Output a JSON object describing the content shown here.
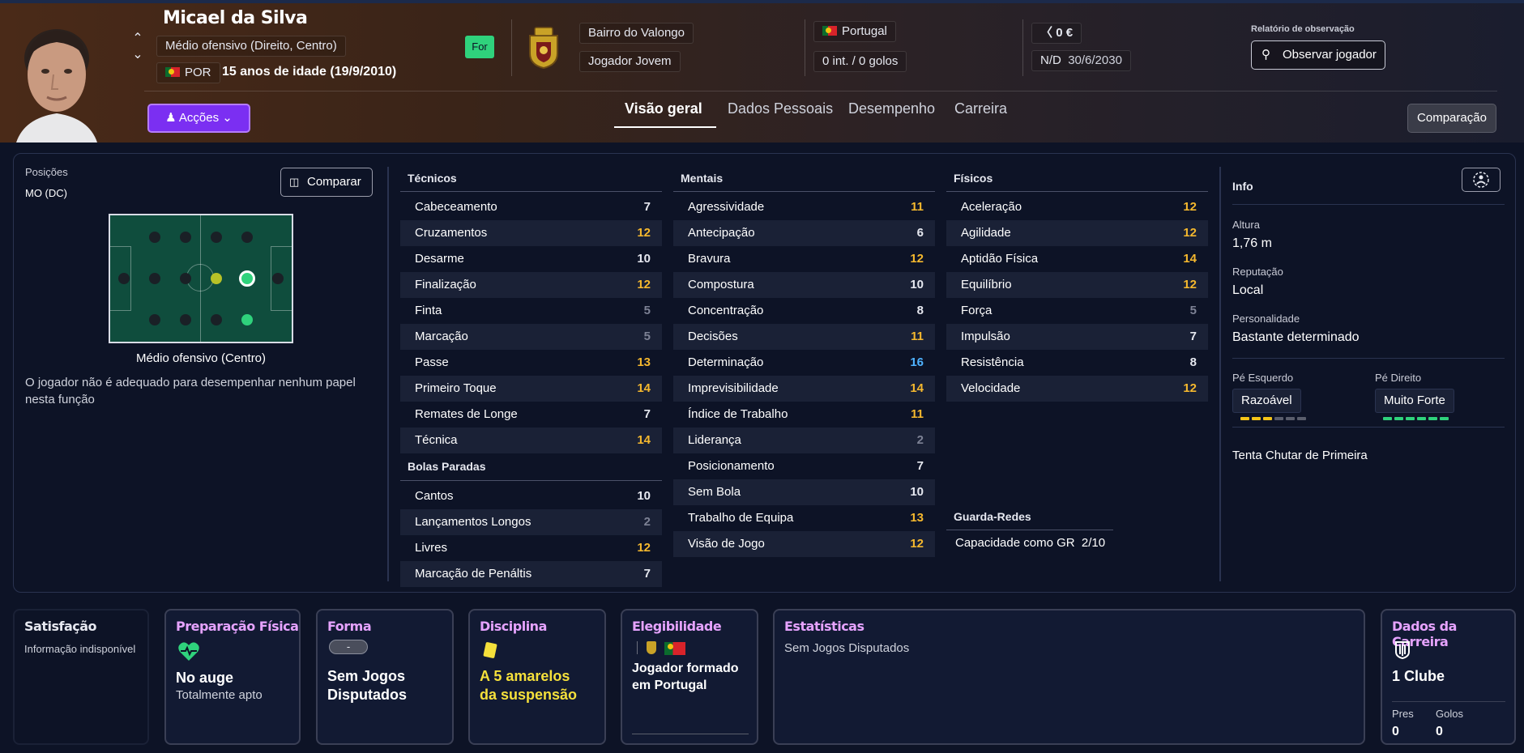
{
  "header": {
    "name": "Micael da Silva",
    "position": "Médio ofensivo (Direito, Centro)",
    "nationality_code": "POR",
    "age_text": "15 anos de idade (19/9/2010)",
    "for_badge": "For",
    "club": "Bairro do Valongo",
    "squad": "Jogador Jovem",
    "country": "Portugal",
    "caps_goals": "0 int. / 0 golos",
    "value": "0 €",
    "contract_label": "N/D",
    "contract_date": "30/6/2030",
    "scout_report_label": "Relatório de observação",
    "observe_button": "Observar jogador",
    "actions_button": "Acções",
    "compare_button": "Comparação",
    "tabs": [
      "Visão geral",
      "Dados Pessoais",
      "Desempenho",
      "Carreira"
    ]
  },
  "positions": {
    "label": "Posições",
    "value": "MO (DC)",
    "compare_button": "Comparar",
    "caption": "Médio ofensivo (Centro)",
    "note": "O jogador não é adequado para desempenhar nenhum papel nesta função"
  },
  "technical": {
    "title": "Técnicos",
    "rows": [
      {
        "name": "Cabeceamento",
        "value": "7"
      },
      {
        "name": "Cruzamentos",
        "value": "12"
      },
      {
        "name": "Desarme",
        "value": "10"
      },
      {
        "name": "Finalização",
        "value": "12"
      },
      {
        "name": "Finta",
        "value": "5"
      },
      {
        "name": "Marcação",
        "value": "5"
      },
      {
        "name": "Passe",
        "value": "13"
      },
      {
        "name": "Primeiro Toque",
        "value": "14"
      },
      {
        "name": "Remates de Longe",
        "value": "7"
      },
      {
        "name": "Técnica",
        "value": "14"
      }
    ]
  },
  "set_pieces": {
    "title": "Bolas Paradas",
    "rows": [
      {
        "name": "Cantos",
        "value": "10"
      },
      {
        "name": "Lançamentos Longos",
        "value": "2"
      },
      {
        "name": "Livres",
        "value": "12"
      },
      {
        "name": "Marcação de Penáltis",
        "value": "7"
      }
    ]
  },
  "mental": {
    "title": "Mentais",
    "rows": [
      {
        "name": "Agressividade",
        "value": "11"
      },
      {
        "name": "Antecipação",
        "value": "6"
      },
      {
        "name": "Bravura",
        "value": "12"
      },
      {
        "name": "Compostura",
        "value": "10"
      },
      {
        "name": "Concentração",
        "value": "8"
      },
      {
        "name": "Decisões",
        "value": "11"
      },
      {
        "name": "Determinação",
        "value": "16"
      },
      {
        "name": "Imprevisibilidade",
        "value": "14"
      },
      {
        "name": "Índice de Trabalho",
        "value": "11"
      },
      {
        "name": "Liderança",
        "value": "2"
      },
      {
        "name": "Posicionamento",
        "value": "7"
      },
      {
        "name": "Sem Bola",
        "value": "10"
      },
      {
        "name": "Trabalho de Equipa",
        "value": "13"
      },
      {
        "name": "Visão de Jogo",
        "value": "12"
      }
    ]
  },
  "physical": {
    "title": "Físicos",
    "rows": [
      {
        "name": "Aceleração",
        "value": "12"
      },
      {
        "name": "Agilidade",
        "value": "12"
      },
      {
        "name": "Aptidão Física",
        "value": "14"
      },
      {
        "name": "Equilíbrio",
        "value": "12"
      },
      {
        "name": "Força",
        "value": "5"
      },
      {
        "name": "Impulsão",
        "value": "7"
      },
      {
        "name": "Resistência",
        "value": "8"
      },
      {
        "name": "Velocidade",
        "value": "12"
      }
    ]
  },
  "goalkeeper": {
    "title": "Guarda-Redes",
    "label": "Capacidade como GR",
    "value": "2/10"
  },
  "info": {
    "title": "Info",
    "height_label": "Altura",
    "height": "1,76 m",
    "reputation_label": "Reputação",
    "reputation": "Local",
    "personality_label": "Personalidade",
    "personality": "Bastante determinado",
    "left_foot_label": "Pé Esquerdo",
    "left_foot": "Razoável",
    "left_foot_level": 3,
    "right_foot_label": "Pé Direito",
    "right_foot": "Muito Forte",
    "right_foot_level": 6,
    "trait": "Tenta Chutar de Primeira"
  },
  "cards": {
    "satisfaction": {
      "title": "Satisfação",
      "text": "Informação indisponível"
    },
    "fitness": {
      "title": "Preparação Física",
      "big": "No auge",
      "small": "Totalmente apto"
    },
    "form": {
      "title": "Forma",
      "chip": "-",
      "big_line1": "Sem Jogos",
      "big_line2": "Disputados"
    },
    "discipline": {
      "title": "Disciplina",
      "big_line1": "A 5 amarelos",
      "big_line2": "da suspensão"
    },
    "eligibility": {
      "title": "Elegibilidade",
      "big_line1": "Jogador formado",
      "big_line2": "em Portugal"
    },
    "stats": {
      "title": "Estatísticas",
      "text": "Sem Jogos Disputados"
    },
    "career": {
      "title": "Dados da Carreira",
      "clubs": "1 Clube",
      "apps_label": "Pres",
      "apps": "0",
      "goals_label": "Golos",
      "goals": "0"
    }
  },
  "colors": {
    "accent_purple": "#7b2ff2",
    "value_gold": "#f5b82e",
    "value_blue": "#4fb3ff",
    "value_grey": "#7d8295",
    "card_title": "#e6a3ff",
    "fit_green": "#2fd27c"
  }
}
